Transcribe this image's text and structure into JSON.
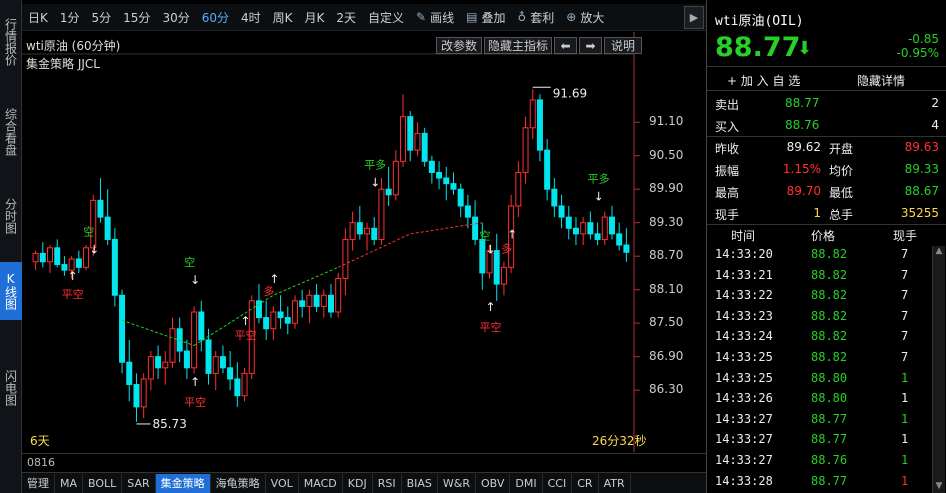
{
  "vtabs": [
    {
      "label": "行情报价"
    },
    {
      "label": "综合看盘"
    },
    {
      "label": "分时图"
    },
    {
      "label": "K线图"
    },
    {
      "label": "闪电图"
    }
  ],
  "toolbar": {
    "periods": [
      "日K",
      "1分",
      "5分",
      "15分",
      "30分",
      "60分",
      "4时",
      "周K",
      "月K",
      "2天",
      "自定义"
    ],
    "active_period": "60分",
    "draw": "画线",
    "overlay": "叠加",
    "arb": "套利",
    "zoom": "放大"
  },
  "chart": {
    "title": "wti原油 (60分钟)",
    "strategy": "集金策略 JJCL",
    "buttons": {
      "params": "改参数",
      "hide_main": "隐藏主指标",
      "explain": "说明"
    },
    "price_labels": [
      "91.10",
      "90.50",
      "89.90",
      "89.30",
      "88.70",
      "88.10",
      "87.50",
      "86.90",
      "86.30"
    ],
    "high_mark": "91.69",
    "low_mark": "85.73",
    "left_bottom": "6天",
    "right_bottom": "26分32秒",
    "signals": [
      {
        "text": "平空",
        "color": "#ff3030"
      },
      {
        "text": "空",
        "color": "#26d026"
      },
      {
        "text": "空",
        "color": "#26d026"
      },
      {
        "text": "平空",
        "color": "#ff3030"
      },
      {
        "text": "平空",
        "color": "#ff3030"
      },
      {
        "text": "多",
        "color": "#ff3030"
      },
      {
        "text": "平多",
        "color": "#26d026"
      },
      {
        "text": "空",
        "color": "#26d026"
      },
      {
        "text": "平空",
        "color": "#ff3030"
      },
      {
        "text": "多",
        "color": "#ff3030"
      },
      {
        "text": "平多",
        "color": "#26d026"
      }
    ]
  },
  "sub": {
    "date": "0816"
  },
  "indicators": [
    "管理",
    "MA",
    "BOLL",
    "SAR",
    "集金策略",
    "海龟策略",
    "VOL",
    "MACD",
    "KDJ",
    "RSI",
    "BIAS",
    "W&R",
    "OBV",
    "DMI",
    "CCI",
    "CR",
    "ATR"
  ],
  "active_indicator": "集金策略",
  "quote": {
    "name": "wti原油(OIL)",
    "price": "88.77",
    "change": "-0.85",
    "change_pct": "-0.95%",
    "add_watch": "+ 加 入 自 选",
    "hide_detail": "隐藏详情",
    "sell_label": "卖出",
    "sell": "88.77",
    "sell_vol": "2",
    "buy_label": "买入",
    "buy": "88.76",
    "buy_vol": "4",
    "prev_close_label": "昨收",
    "prev_close": "89.62",
    "open_label": "开盘",
    "open": "89.63",
    "amp_label": "振幅",
    "amp": "1.15%",
    "avg_label": "均价",
    "avg": "89.33",
    "high_label": "最高",
    "high": "89.70",
    "low_label": "最低",
    "low": "88.67",
    "cur_vol_label": "现手",
    "cur_vol": "1",
    "total_vol_label": "总手",
    "total_vol": "35255"
  },
  "ticks": {
    "headers": [
      "时间",
      "价格",
      "现手"
    ],
    "rows": [
      {
        "t": "14:33:20",
        "p": "88.82",
        "v": "7",
        "vc": "white"
      },
      {
        "t": "14:33:21",
        "p": "88.82",
        "v": "7",
        "vc": "white"
      },
      {
        "t": "14:33:22",
        "p": "88.82",
        "v": "7",
        "vc": "white"
      },
      {
        "t": "14:33:23",
        "p": "88.82",
        "v": "7",
        "vc": "white"
      },
      {
        "t": "14:33:24",
        "p": "88.82",
        "v": "7",
        "vc": "white"
      },
      {
        "t": "14:33:25",
        "p": "88.82",
        "v": "7",
        "vc": "white"
      },
      {
        "t": "14:33:25",
        "p": "88.80",
        "v": "1",
        "vc": "green"
      },
      {
        "t": "14:33:26",
        "p": "88.80",
        "v": "1",
        "vc": "white"
      },
      {
        "t": "14:33:27",
        "p": "88.77",
        "v": "1",
        "vc": "green"
      },
      {
        "t": "14:33:27",
        "p": "88.77",
        "v": "1",
        "vc": "white"
      },
      {
        "t": "14:33:27",
        "p": "88.76",
        "v": "1",
        "vc": "green"
      },
      {
        "t": "14:33:28",
        "p": "88.77",
        "v": "1",
        "vc": "red"
      }
    ]
  },
  "chart_data": {
    "type": "candlestick",
    "title": "wti原油 (60分钟)",
    "y_ticks": [
      91.1,
      90.5,
      89.9,
      89.3,
      88.7,
      88.1,
      87.5,
      86.9,
      86.3
    ],
    "ylim": [
      85.55,
      92.0
    ],
    "candles": [
      [
        88.6,
        88.8,
        88.45,
        88.75
      ],
      [
        88.75,
        88.95,
        88.5,
        88.6
      ],
      [
        88.6,
        88.9,
        88.4,
        88.85
      ],
      [
        88.85,
        89.0,
        88.5,
        88.55
      ],
      [
        88.55,
        88.7,
        88.35,
        88.45
      ],
      [
        88.45,
        88.7,
        88.3,
        88.65
      ],
      [
        88.65,
        88.8,
        88.4,
        88.5
      ],
      [
        88.5,
        88.9,
        88.45,
        88.85
      ],
      [
        88.85,
        89.8,
        88.7,
        89.7
      ],
      [
        89.7,
        90.1,
        89.3,
        89.4
      ],
      [
        89.4,
        89.9,
        88.9,
        89.0
      ],
      [
        89.0,
        89.2,
        87.8,
        88.0
      ],
      [
        88.0,
        88.1,
        86.6,
        86.8
      ],
      [
        86.8,
        87.2,
        86.1,
        86.4
      ],
      [
        86.4,
        86.6,
        85.73,
        86.0
      ],
      [
        86.0,
        86.6,
        85.8,
        86.5
      ],
      [
        86.5,
        87.0,
        86.3,
        86.9
      ],
      [
        86.9,
        87.1,
        86.5,
        86.7
      ],
      [
        86.7,
        87.0,
        86.4,
        86.8
      ],
      [
        86.8,
        87.6,
        86.7,
        87.4
      ],
      [
        87.4,
        87.6,
        86.8,
        87.0
      ],
      [
        87.0,
        87.2,
        86.5,
        86.7
      ],
      [
        86.7,
        87.8,
        86.6,
        87.7
      ],
      [
        87.7,
        87.9,
        87.0,
        87.2
      ],
      [
        87.2,
        87.4,
        86.4,
        86.6
      ],
      [
        86.6,
        87.0,
        86.3,
        86.9
      ],
      [
        86.9,
        87.1,
        86.6,
        86.7
      ],
      [
        86.7,
        87.0,
        86.3,
        86.5
      ],
      [
        86.5,
        86.8,
        86.0,
        86.2
      ],
      [
        86.2,
        86.7,
        86.1,
        86.6
      ],
      [
        86.6,
        88.0,
        86.5,
        87.9
      ],
      [
        87.9,
        88.2,
        87.5,
        87.6
      ],
      [
        87.6,
        87.9,
        87.2,
        87.4
      ],
      [
        87.4,
        87.8,
        87.2,
        87.7
      ],
      [
        87.7,
        88.0,
        87.4,
        87.6
      ],
      [
        87.6,
        87.8,
        87.3,
        87.5
      ],
      [
        87.5,
        88.0,
        87.4,
        87.9
      ],
      [
        87.9,
        88.1,
        87.6,
        87.8
      ],
      [
        87.8,
        88.1,
        87.5,
        88.0
      ],
      [
        88.0,
        88.2,
        87.7,
        87.8
      ],
      [
        87.8,
        88.1,
        87.6,
        88.0
      ],
      [
        88.0,
        88.2,
        87.6,
        87.7
      ],
      [
        87.7,
        88.4,
        87.6,
        88.3
      ],
      [
        88.3,
        89.2,
        88.0,
        89.0
      ],
      [
        89.0,
        89.5,
        88.8,
        89.3
      ],
      [
        89.3,
        89.6,
        89.0,
        89.1
      ],
      [
        89.1,
        89.3,
        88.8,
        89.2
      ],
      [
        89.2,
        89.4,
        88.9,
        89.0
      ],
      [
        89.0,
        90.1,
        88.9,
        89.9
      ],
      [
        89.9,
        90.3,
        89.6,
        89.8
      ],
      [
        89.8,
        90.6,
        89.7,
        90.4
      ],
      [
        90.4,
        91.6,
        90.3,
        91.2
      ],
      [
        91.2,
        91.3,
        90.4,
        90.6
      ],
      [
        90.6,
        91.1,
        90.5,
        90.9
      ],
      [
        90.9,
        91.0,
        90.3,
        90.4
      ],
      [
        90.4,
        90.5,
        90.0,
        90.2
      ],
      [
        90.2,
        90.4,
        89.9,
        90.1
      ],
      [
        90.1,
        90.3,
        89.7,
        90.0
      ],
      [
        90.0,
        90.2,
        89.8,
        89.9
      ],
      [
        89.9,
        90.0,
        89.4,
        89.6
      ],
      [
        89.6,
        89.8,
        89.2,
        89.4
      ],
      [
        89.4,
        89.7,
        88.9,
        89.0
      ],
      [
        89.0,
        89.3,
        88.1,
        88.4
      ],
      [
        88.4,
        88.9,
        88.3,
        88.8
      ],
      [
        88.8,
        89.1,
        87.9,
        88.2
      ],
      [
        88.2,
        88.6,
        88.0,
        88.5
      ],
      [
        88.5,
        89.8,
        88.4,
        89.6
      ],
      [
        89.6,
        90.4,
        89.4,
        90.2
      ],
      [
        90.2,
        91.2,
        90.0,
        91.0
      ],
      [
        91.0,
        91.69,
        90.8,
        91.5
      ],
      [
        91.5,
        91.6,
        90.4,
        90.6
      ],
      [
        90.6,
        90.8,
        89.7,
        89.9
      ],
      [
        89.9,
        90.1,
        89.4,
        89.6
      ],
      [
        89.6,
        89.8,
        89.2,
        89.4
      ],
      [
        89.4,
        89.6,
        89.0,
        89.2
      ],
      [
        89.2,
        89.4,
        88.9,
        89.1
      ],
      [
        89.1,
        89.4,
        88.9,
        89.3
      ],
      [
        89.3,
        89.5,
        89.0,
        89.1
      ],
      [
        89.1,
        89.3,
        88.9,
        89.0
      ],
      [
        89.0,
        89.5,
        88.9,
        89.4
      ],
      [
        89.4,
        89.6,
        89.0,
        89.1
      ],
      [
        89.1,
        89.3,
        88.8,
        88.9
      ],
      [
        88.9,
        89.2,
        88.6,
        88.77
      ]
    ]
  }
}
